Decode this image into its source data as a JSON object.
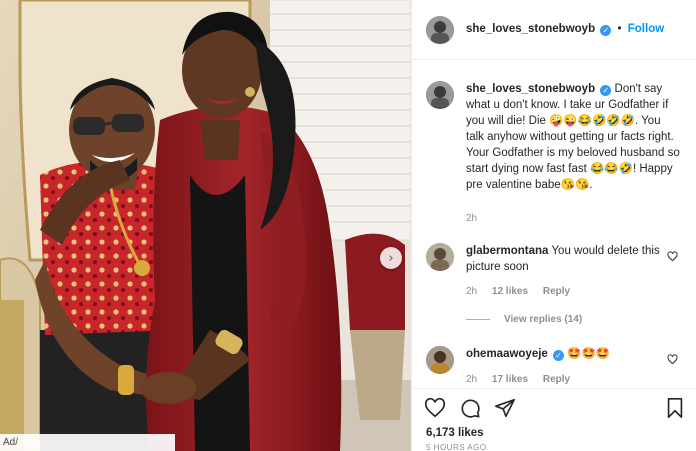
{
  "post": {
    "username": "she_loves_stonebwoyb",
    "follow_label": "Follow",
    "separator": "•",
    "verified_glyph": "✓",
    "photo_caption": "Ad/",
    "next_glyph": "›"
  },
  "comments": [
    {
      "username": "she_loves_stonebwoyb",
      "verified": true,
      "text": "Don't say what u don't know. I take ur Godfather if you will die! Die 🤪😜😂🤣🤣🤣. You talk anyhow without getting ur facts right. Your Godfather is my beloved husband so start dying now fast fast 😂😂🤣! Happy pre valentine babe😘😘.",
      "time": "2h"
    },
    {
      "username": "glabermontana",
      "verified": false,
      "text": "You would delete this picture soon",
      "time": "2h",
      "likes": "12 likes",
      "reply": "Reply",
      "view_replies": "View replies (14)"
    },
    {
      "username": "ohemaawoyeje",
      "verified": true,
      "text": "🤩🤩🤩",
      "time": "2h",
      "likes": "17 likes",
      "reply": "Reply"
    }
  ],
  "actions": {
    "like_icon": "heart-outline-icon",
    "comment_icon": "comment-bubble-icon",
    "share_icon": "paper-plane-icon",
    "save_icon": "bookmark-icon",
    "likes_count": "6,173 likes",
    "post_age": "5 HOURS AGO"
  },
  "colors": {
    "accent": "#0095f6",
    "verified": "#3897f0",
    "text": "#262626",
    "muted": "#8e8e8e",
    "divider": "#efefef"
  }
}
